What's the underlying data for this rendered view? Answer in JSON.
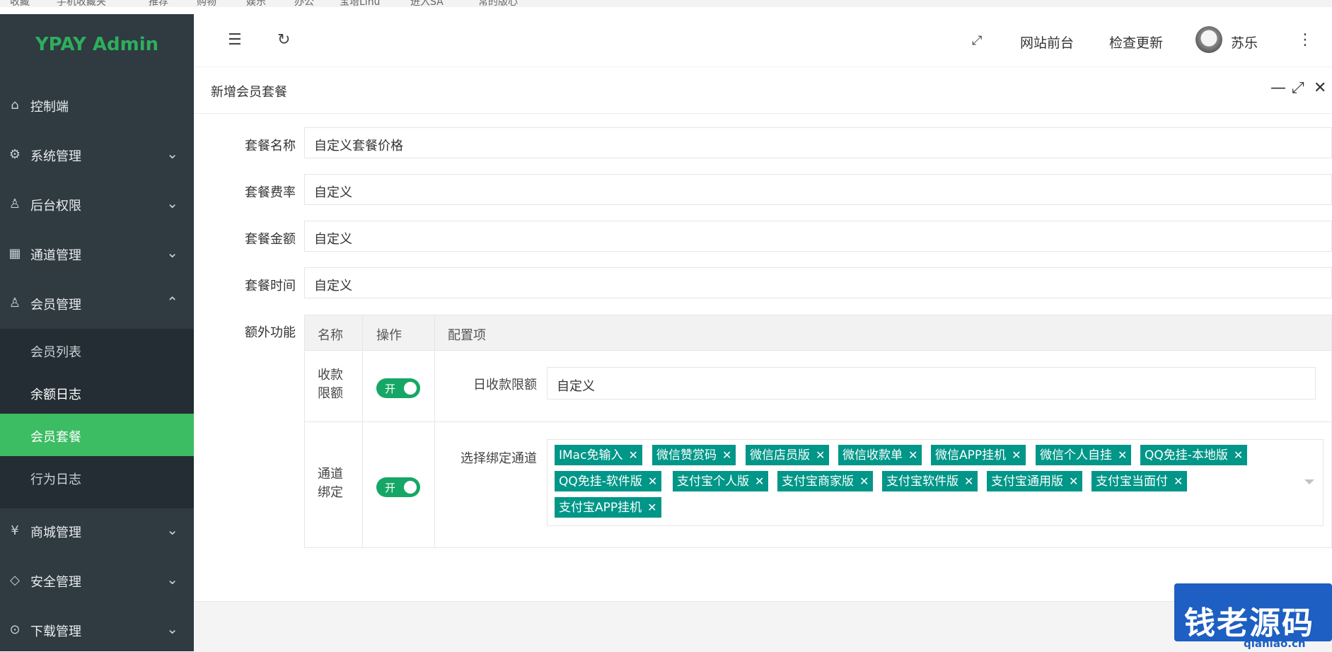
{
  "bookmarks": [
    "收藏",
    "手机收藏夹",
    "推荐",
    "购物",
    "娱乐",
    "办公",
    "宝塔Linu",
    "进入SA",
    "常的版心"
  ],
  "app": {
    "title": "YPAY Admin"
  },
  "sidebar": {
    "items": [
      {
        "label": "控制端",
        "icon": "home-icon"
      },
      {
        "label": "系统管理",
        "icon": "gear-icon"
      },
      {
        "label": "后台权限",
        "icon": "user-icon"
      },
      {
        "label": "通道管理",
        "icon": "grid-icon"
      },
      {
        "label": "会员管理",
        "icon": "user-icon"
      },
      {
        "label": "商城管理",
        "icon": "yen-icon"
      },
      {
        "label": "安全管理",
        "icon": "diamond-icon"
      },
      {
        "label": "下载管理",
        "icon": "download-icon"
      }
    ],
    "submenu": [
      {
        "label": "会员列表"
      },
      {
        "label": "余额日志"
      },
      {
        "label": "会员套餐",
        "active": true
      },
      {
        "label": "行为日志"
      }
    ]
  },
  "header": {
    "site_front": "网站前台",
    "check_update": "检查更新",
    "user_name": "苏乐"
  },
  "panel": {
    "title": "新增会员套餐"
  },
  "form": {
    "fields": [
      {
        "label": "套餐名称",
        "value": "自定义套餐价格"
      },
      {
        "label": "套餐费率",
        "value": "自定义"
      },
      {
        "label": "套餐金额",
        "value": "自定义"
      },
      {
        "label": "套餐时间",
        "value": "自定义"
      }
    ],
    "extra_label": "额外功能",
    "table": {
      "headers": [
        "名称",
        "操作",
        "配置项"
      ],
      "rows": [
        {
          "name": "收款限额",
          "switch": "开",
          "config_label": "日收款限额",
          "config_value": "自定义"
        },
        {
          "name": "通道绑定",
          "switch": "开",
          "config_label": "选择绑定通道"
        }
      ]
    },
    "channels": [
      "IMac免输入",
      "微信赞赏码",
      "微信店员版",
      "微信收款单",
      "微信APP挂机",
      "微信个人自挂",
      "QQ免挂-本地版",
      "QQ免挂-软件版",
      "支付宝个人版",
      "支付宝商家版",
      "支付宝软件版",
      "支付宝通用版",
      "支付宝当面付",
      "支付宝APP挂机"
    ]
  },
  "watermark": {
    "text": "钱老源码",
    "url": "qianlao.cn"
  }
}
